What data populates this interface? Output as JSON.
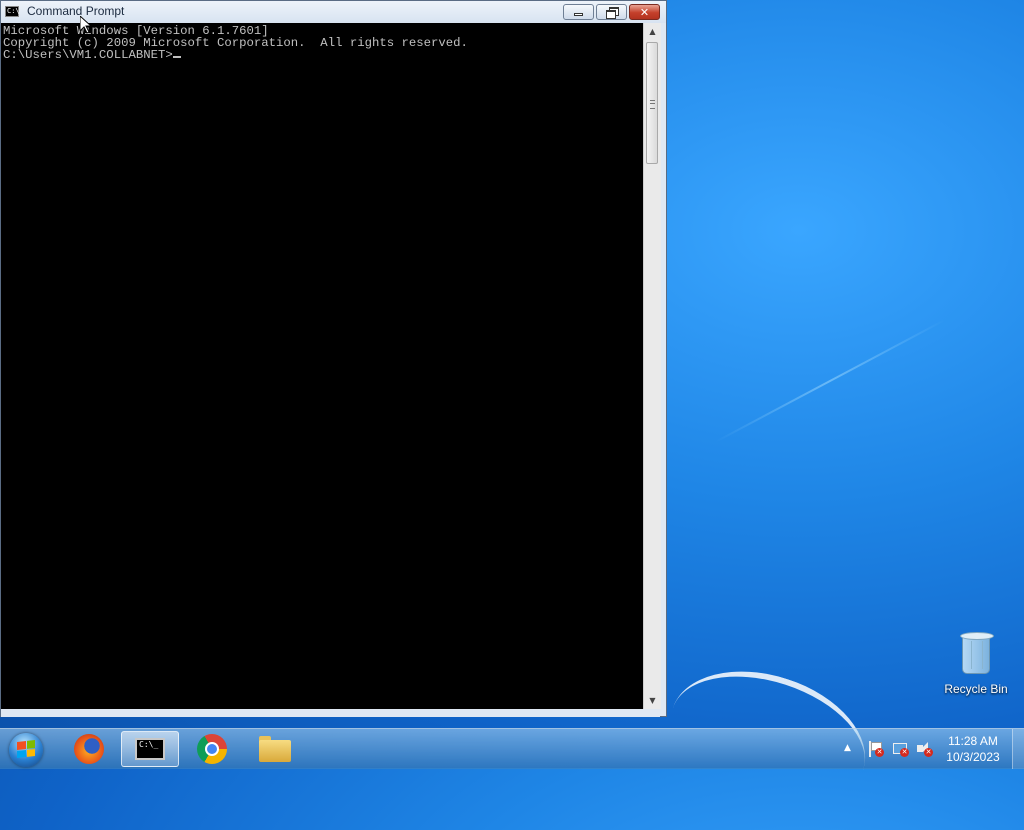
{
  "window": {
    "title": "Command Prompt",
    "icon_glyph": "C:\\",
    "controls": {
      "minimize": "minimize-icon",
      "maximize": "restore-icon",
      "close": "close-icon",
      "close_glyph": "✕"
    },
    "console": {
      "lines": [
        "Microsoft Windows [Version 6.1.7601]",
        "Copyright (c) 2009 Microsoft Corporation.  All rights reserved.",
        "",
        "C:\\Users\\VM1.COLLABNET>"
      ]
    }
  },
  "desktop": {
    "recycle_bin": {
      "label": "Recycle Bin",
      "icon": "recycle-bin-icon"
    }
  },
  "taskbar": {
    "start": {
      "icon": "windows-start-orb-icon"
    },
    "items": [
      {
        "name": "Firefox",
        "icon": "firefox-icon"
      },
      {
        "name": "Command Prompt",
        "icon": "command-prompt-icon",
        "glyph": "C:\\_"
      },
      {
        "name": "Google Chrome",
        "icon": "chrome-icon"
      },
      {
        "name": "Windows Explorer",
        "icon": "folder-icon"
      }
    ],
    "tray": {
      "show_hidden": "▲",
      "icons": [
        "action-center-flag-icon",
        "network-icon",
        "volume-icon"
      ],
      "error_mark": "✕",
      "time": "11:28 AM",
      "date": "10/3/2023"
    }
  },
  "colors": {
    "console_bg": "#000000",
    "console_fg": "#c0c0c0",
    "desktop_blue": "#1f86e6",
    "close_red": "#c4402b"
  }
}
